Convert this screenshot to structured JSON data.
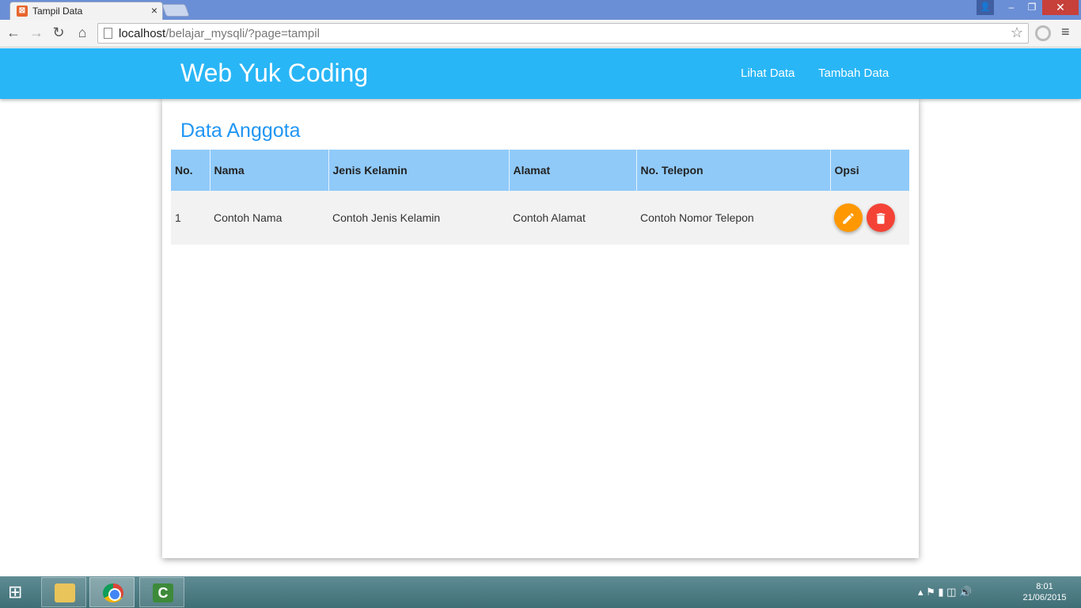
{
  "browser": {
    "tab_title": "Tampil Data",
    "tab_close": "×",
    "url_host": "localhost",
    "url_path": "/belajar_mysqli/?page=tampil",
    "window_min": "–",
    "window_max": "❐",
    "window_close": "✕"
  },
  "navbar": {
    "brand": "Web Yuk Coding",
    "links": [
      "Lihat Data",
      "Tambah Data"
    ],
    "color": "#29b6f6"
  },
  "main": {
    "title": "Data Anggota",
    "table": {
      "headers": [
        "No.",
        "Nama",
        "Jenis Kelamin",
        "Alamat",
        "No. Telepon",
        "Opsi"
      ],
      "rows": [
        {
          "no": "1",
          "nama": "Contoh Nama",
          "jenis_kelamin": "Contoh Jenis Kelamin",
          "alamat": "Contoh Alamat",
          "telepon": "Contoh Nomor Telepon"
        }
      ]
    },
    "actions": {
      "edit_icon": "pencil-icon",
      "delete_icon": "trash-icon"
    }
  },
  "taskbar": {
    "time": "8:01",
    "date": "21/06/2015"
  }
}
